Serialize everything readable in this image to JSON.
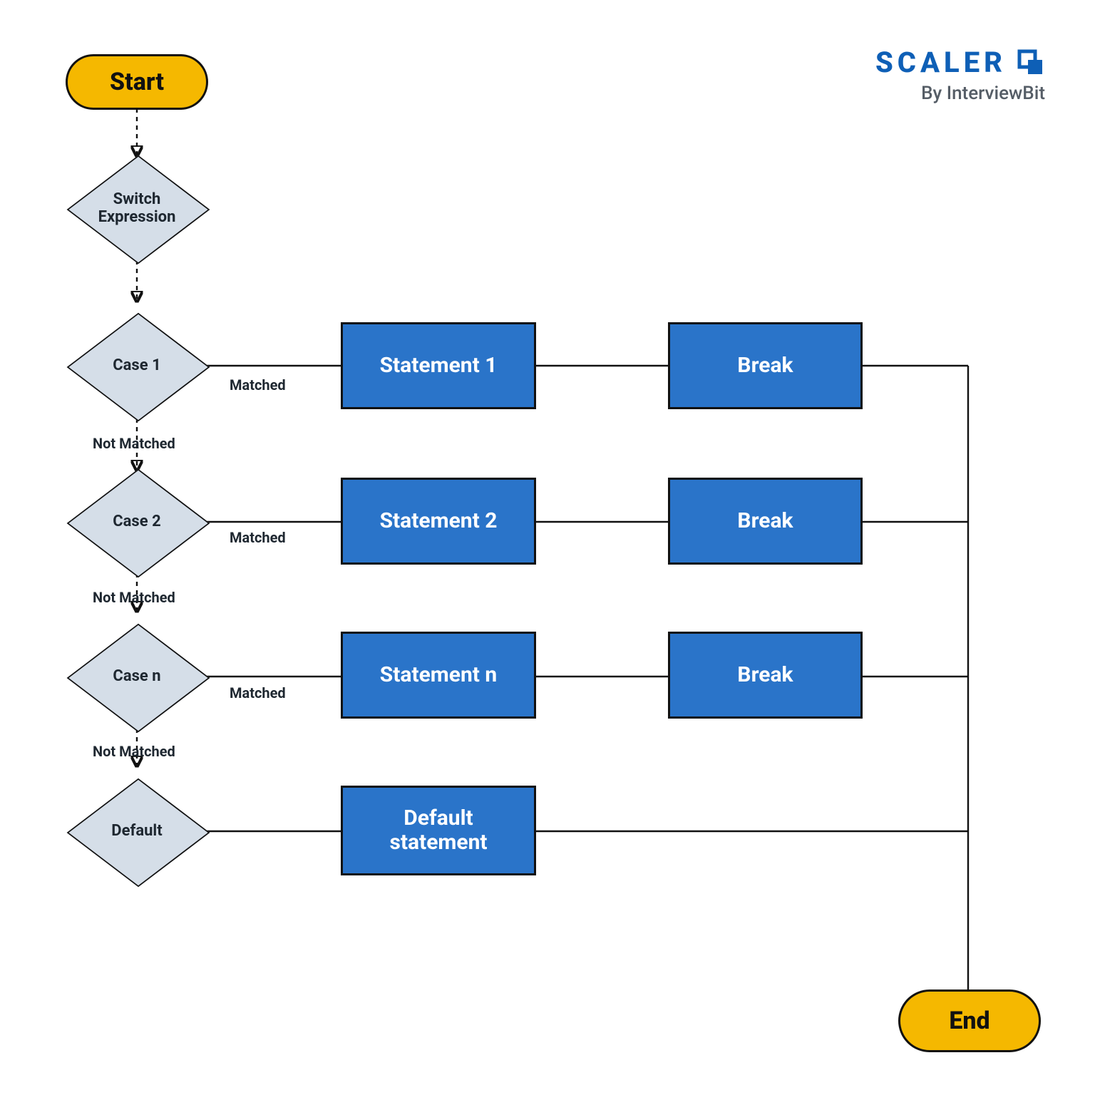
{
  "brand": {
    "name": "SCALER",
    "byline": "By InterviewBit"
  },
  "terminators": {
    "start": "Start",
    "end": "End"
  },
  "decisions": {
    "switch": "Switch\nExpression",
    "case1": "Case 1",
    "case2": "Case 2",
    "casen": "Case n",
    "default": "Default"
  },
  "processes": {
    "stmt1": "Statement 1",
    "stmt2": "Statement 2",
    "stmtn": "Statement n",
    "default": "Default\nstatement",
    "break": "Break"
  },
  "edge_labels": {
    "matched": "Matched",
    "not_matched": "Not Matched"
  },
  "colors": {
    "terminator": "#f5b800",
    "decision": "#d5dee8",
    "process": "#2a74c9",
    "brand": "#0e5fb6"
  }
}
